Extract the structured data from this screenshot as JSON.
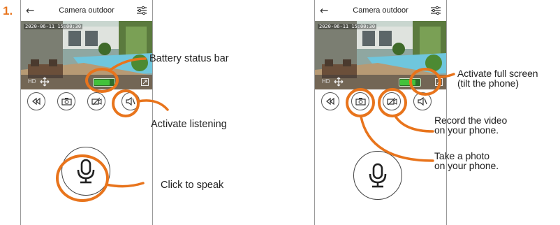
{
  "step_number": "1.",
  "phone": {
    "title": "Camera outdoor",
    "timestamp": "2020-06-11 15:00:30",
    "quality_label": "HD"
  },
  "annotations": {
    "battery": "Battery status bar",
    "listening": "Activate listening",
    "speak": "Click to speak",
    "fullscreen_line1": "Activate full screen",
    "fullscreen_line2": "(tilt the phone)",
    "record_line1": "Record the video",
    "record_line2": "on your phone.",
    "photo_line1": "Take a photo",
    "photo_line2": "on your phone."
  },
  "colors": {
    "accent": "#e8741c",
    "battery": "#43c23b"
  },
  "icons": [
    "back-arrow-icon",
    "settings-sliders-icon",
    "pan-move-icon",
    "fullscreen-icon",
    "rewind-icon",
    "camera-icon",
    "video-off-icon",
    "speaker-mute-icon",
    "microphone-icon"
  ]
}
